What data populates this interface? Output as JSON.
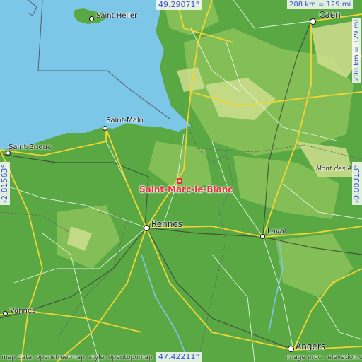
{
  "place": {
    "name": "Saint-Marc-le-Blanc"
  },
  "bounds": {
    "north": "49.29071°",
    "south": "47.42211°",
    "west": "-2.81563°",
    "east": "-0.00313°"
  },
  "scale": {
    "top": "208 km = 129 mi",
    "right": "208 km = 129 mi"
  },
  "cities": [
    {
      "id": "saint-helier",
      "name": "Saint Helier"
    },
    {
      "id": "caen",
      "name": "Caen"
    },
    {
      "id": "saint-malo",
      "name": "Saint-Malo"
    },
    {
      "id": "saint-brieuc",
      "name": "Saint-Brieuc"
    },
    {
      "id": "rennes",
      "name": "Rennes"
    },
    {
      "id": "laval",
      "name": "Laval"
    },
    {
      "id": "vannes",
      "name": "Vannes"
    },
    {
      "id": "angers",
      "name": "Angers"
    },
    {
      "id": "mont-des-avaloirs",
      "name": "Mont des A"
    }
  ],
  "credits": {
    "left": "map data: openstreetmap, style: opentopomap",
    "right": "image proc.: elevation.city"
  },
  "colors": {
    "sea": "#7cc7e8",
    "lowland": "#5aa844",
    "midland": "#8cc25a",
    "highland": "#c9dc8c",
    "road_major": "#f2d635",
    "road_minor": "#ffffff",
    "border": "#5a5a6a",
    "accent": "#e8303a",
    "coord_text": "#3a4fd8"
  }
}
